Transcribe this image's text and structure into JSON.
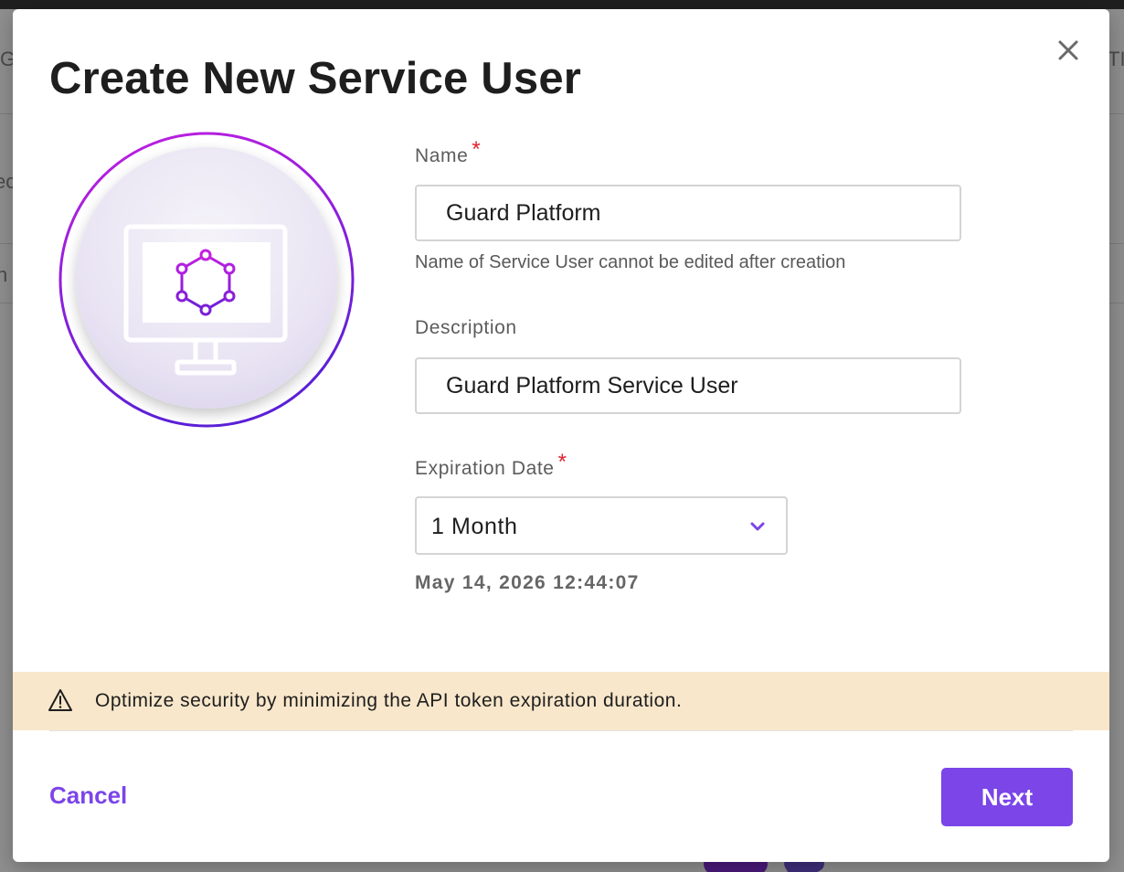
{
  "dialog": {
    "title": "Create New Service User",
    "close_icon": "close-icon",
    "illustration_icon": "service-user-monitor-icon",
    "fields": {
      "name": {
        "label": "Name",
        "required_marker": "*",
        "value": "Guard Platform",
        "helper": "Name of Service User cannot be edited after creation"
      },
      "description": {
        "label": "Description",
        "value": "Guard Platform Service User"
      },
      "expiration": {
        "label": "Expiration Date",
        "required_marker": "*",
        "selected": "1 Month",
        "computed_date": "May 14, 2026 12:44:07"
      }
    },
    "warning": {
      "icon": "warning-triangle-icon",
      "text": "Optimize security by minimizing the API token expiration duration."
    },
    "footer": {
      "cancel_label": "Cancel",
      "next_label": "Next"
    }
  },
  "background": {
    "fragments": [
      "G",
      "ec",
      "n",
      "TI"
    ]
  },
  "colors": {
    "accent": "#7b45e8",
    "required": "#e0212e",
    "warning_bg": "#f9e7cb",
    "ring_gradient_start": "#c31fe0",
    "ring_gradient_end": "#5a1fd8"
  }
}
